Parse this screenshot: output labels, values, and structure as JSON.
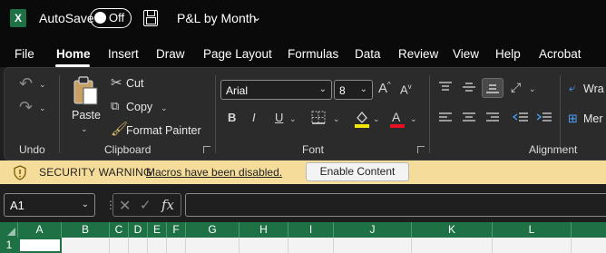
{
  "app": {
    "logo_letter": "X",
    "autosave_label": "AutoSave",
    "autosave_state": "Off",
    "doc_title": "P&L by Month"
  },
  "menu": {
    "tabs": [
      "File",
      "Home",
      "Insert",
      "Draw",
      "Page Layout",
      "Formulas",
      "Data",
      "Review",
      "View",
      "Help",
      "Acrobat"
    ],
    "active": "Home"
  },
  "ribbon": {
    "groups": {
      "undo": "Undo",
      "clipboard": "Clipboard",
      "font": "Font",
      "alignment": "Alignment"
    },
    "clipboard": {
      "paste": "Paste",
      "cut": "Cut",
      "copy": "Copy",
      "format_painter": "Format Painter"
    },
    "font": {
      "name": "Arial",
      "size": "8",
      "bold": "B",
      "italic": "I",
      "underline": "U",
      "grow": "A",
      "shrink": "A",
      "fill_color": "#f2e600",
      "font_color": "#e81123"
    },
    "alignment": {
      "wrap": "Wra",
      "merge": "Mer"
    }
  },
  "security": {
    "title": "SECURITY WARNING",
    "message": "Macros have been disabled.",
    "button": "Enable Content"
  },
  "formula_bar": {
    "name_box": "A1",
    "fx": "fx",
    "value": ""
  },
  "grid": {
    "columns": [
      "A",
      "B",
      "C",
      "D",
      "E",
      "F",
      "G",
      "H",
      "I",
      "J",
      "K",
      "L"
    ],
    "rows": [
      "1"
    ]
  }
}
